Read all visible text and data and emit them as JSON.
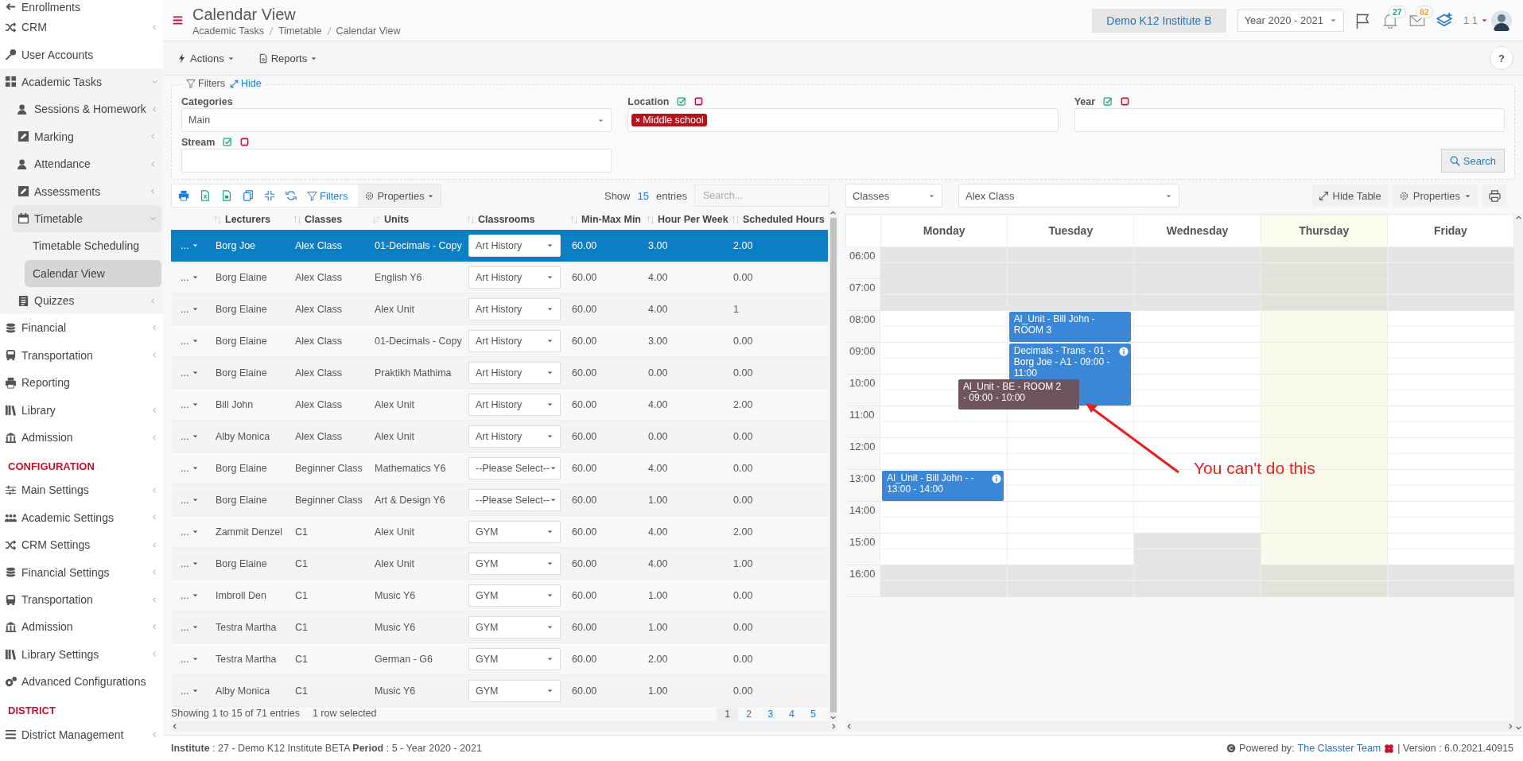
{
  "sidebar": {
    "items": [
      {
        "label": "Enrollments",
        "kind": "link",
        "selected": false
      },
      {
        "label": "CRM",
        "kind": "group",
        "expanded": false,
        "selected": false
      },
      {
        "label": "User Accounts",
        "kind": "link",
        "selected": false
      },
      {
        "label": "Academic Tasks",
        "kind": "group",
        "expanded": true,
        "selected": false,
        "children": [
          {
            "label": "Sessions & Homework",
            "kind": "group",
            "expanded": false,
            "selected": false
          },
          {
            "label": "Marking",
            "kind": "group",
            "expanded": false,
            "selected": false
          },
          {
            "label": "Attendance",
            "kind": "group",
            "expanded": false,
            "selected": false
          },
          {
            "label": "Assessments",
            "kind": "group",
            "expanded": false,
            "selected": false
          },
          {
            "label": "Timetable",
            "kind": "group",
            "expanded": true,
            "selected": false,
            "children": [
              {
                "label": "Timetable Scheduling",
                "kind": "link",
                "selected": false
              },
              {
                "label": "Calendar View",
                "kind": "link",
                "selected": true
              }
            ]
          },
          {
            "label": "Quizzes",
            "kind": "group",
            "expanded": false,
            "selected": false
          }
        ]
      },
      {
        "label": "Financial",
        "kind": "group",
        "expanded": false,
        "selected": false
      },
      {
        "label": "Transportation",
        "kind": "group",
        "expanded": false,
        "selected": false
      },
      {
        "label": "Reporting",
        "kind": "link",
        "selected": false
      },
      {
        "label": "Library",
        "kind": "group",
        "expanded": false,
        "selected": false
      },
      {
        "label": "Admission",
        "kind": "group",
        "expanded": false,
        "selected": false
      },
      {
        "label": "CONFIGURATION",
        "kind": "heading"
      },
      {
        "label": "Main Settings",
        "kind": "group",
        "expanded": false,
        "selected": false
      },
      {
        "label": "Academic Settings",
        "kind": "group",
        "expanded": false,
        "selected": false
      },
      {
        "label": "CRM Settings",
        "kind": "group",
        "expanded": false,
        "selected": false
      },
      {
        "label": "Financial Settings",
        "kind": "group",
        "expanded": false,
        "selected": false
      },
      {
        "label": "Transportation",
        "kind": "group",
        "expanded": false,
        "selected": false
      },
      {
        "label": "Admission",
        "kind": "group",
        "expanded": false,
        "selected": false
      },
      {
        "label": "Library Settings",
        "kind": "group",
        "expanded": false,
        "selected": false
      },
      {
        "label": "Advanced Configurations",
        "kind": "link",
        "selected": false
      },
      {
        "label": "DISTRICT",
        "kind": "heading"
      },
      {
        "label": "District Management",
        "kind": "group",
        "expanded": false,
        "selected": false
      }
    ]
  },
  "header": {
    "title": "Calendar View",
    "breadcrumb": [
      "Academic Tasks",
      "Timetable",
      "Calendar View"
    ],
    "institute": "Demo K12 Institute B",
    "year": "Year 2020 - 2021",
    "badges": [
      {
        "kind": "notifications",
        "count": "27",
        "color": "#1fa882"
      },
      {
        "kind": "messages",
        "count": "82",
        "color": "#f0a33a"
      }
    ],
    "user": "1 1"
  },
  "toolbar": {
    "menus": [
      "Actions",
      "Reports"
    ],
    "help": "?"
  },
  "filters": {
    "title": "Filters",
    "toggle": "Hide",
    "fields": [
      {
        "label": "Categories",
        "kind": "select",
        "value": "Main",
        "bulk": false
      },
      {
        "label": "Location",
        "kind": "tags",
        "tags": [
          "Middle school"
        ],
        "bulk": true
      },
      {
        "label": "Year",
        "kind": "text",
        "bulk": true
      },
      {
        "label": "Stream",
        "kind": "text",
        "bulk": true
      }
    ],
    "search_button": "Search"
  },
  "table": {
    "toolbar": {
      "filters": "Filters",
      "properties": "Properties",
      "show": "Show",
      "page_size": "15",
      "entries": "entries",
      "search_placeholder": "Search..."
    },
    "columns": [
      {
        "label": "Lecturers",
        "kind": "text",
        "sorted": false
      },
      {
        "label": "Classes",
        "kind": "text",
        "sorted": false
      },
      {
        "label": "Units",
        "kind": "text",
        "sorted": true
      },
      {
        "label": "Classrooms",
        "kind": "select",
        "sorted": false
      },
      {
        "label": "Min-Max Min",
        "kind": "text",
        "sorted": false
      },
      {
        "label": "Hour Per Week",
        "kind": "text",
        "sorted": false
      },
      {
        "label": "Scheduled Hours",
        "kind": "text",
        "sorted": false
      }
    ],
    "rows": [
      {
        "selected": true,
        "action": "...",
        "cells": [
          "Borg Joe",
          "Alex Class",
          "01-Decimals - Copy",
          "Art History",
          "60.00",
          "3.00",
          "2.00"
        ]
      },
      {
        "selected": false,
        "action": "...",
        "cells": [
          "Borg Elaine",
          "Alex Class",
          "English Y6",
          "Art History",
          "60.00",
          "4.00",
          "0.00"
        ]
      },
      {
        "selected": false,
        "action": "...",
        "cells": [
          "Borg Elaine",
          "Alex Class",
          "Alex Unit",
          "Art History",
          "60.00",
          "4.00",
          "1"
        ]
      },
      {
        "selected": false,
        "action": "...",
        "cells": [
          "Borg Elaine",
          "Alex Class",
          "01-Decimals - Copy",
          "Art History",
          "60.00",
          "3.00",
          "0.00"
        ]
      },
      {
        "selected": false,
        "action": "...",
        "cells": [
          "Borg Elaine",
          "Alex Class",
          "Praktikh Mathima",
          "Art History",
          "60.00",
          "0.00",
          "0.00"
        ]
      },
      {
        "selected": false,
        "action": "...",
        "cells": [
          "Bill John",
          "Alex Class",
          "Alex Unit",
          "Art History",
          "60.00",
          "4.00",
          "2.00"
        ]
      },
      {
        "selected": false,
        "action": "...",
        "cells": [
          "Alby Monica",
          "Alex Class",
          "Alex Unit",
          "Art History",
          "60.00",
          "0.00",
          "0.00"
        ]
      },
      {
        "selected": false,
        "action": "...",
        "cells": [
          "Borg Elaine",
          "Beginner Class",
          "Mathematics Y6",
          "--Please Select--",
          "60.00",
          "4.00",
          "0.00"
        ]
      },
      {
        "selected": false,
        "action": "...",
        "cells": [
          "Borg Elaine",
          "Beginner Class",
          "Art & Design Y6",
          "--Please Select--",
          "60.00",
          "1.00",
          "0.00"
        ]
      },
      {
        "selected": false,
        "action": "...",
        "cells": [
          "Zammit Denzel",
          "C1",
          "Alex Unit",
          "GYM",
          "60.00",
          "4.00",
          "2.00"
        ]
      },
      {
        "selected": false,
        "action": "...",
        "cells": [
          "Borg Elaine",
          "C1",
          "Alex Unit",
          "GYM",
          "60.00",
          "4.00",
          "1.00"
        ]
      },
      {
        "selected": false,
        "action": "...",
        "cells": [
          "Imbroll Den",
          "C1",
          "Music Y6",
          "GYM",
          "60.00",
          "1.00",
          "0.00"
        ]
      },
      {
        "selected": false,
        "action": "...",
        "cells": [
          "Testra Martha",
          "C1",
          "Music Y6",
          "GYM",
          "60.00",
          "1.00",
          "0.00"
        ]
      },
      {
        "selected": false,
        "action": "...",
        "cells": [
          "Testra Martha",
          "C1",
          "German - G6",
          "GYM",
          "60.00",
          "2.00",
          "0.00"
        ]
      },
      {
        "selected": false,
        "action": "...",
        "cells": [
          "Alby Monica",
          "C1",
          "Music Y6",
          "GYM",
          "60.00",
          "1.00",
          "0.00"
        ]
      }
    ],
    "info": "Showing 1 to 15 of 71 entries",
    "selection_info": "1 row selected",
    "pages": [
      {
        "label": "1",
        "selected": true
      },
      {
        "label": "2",
        "selected": false
      },
      {
        "label": "3",
        "selected": false
      },
      {
        "label": "4",
        "selected": false
      },
      {
        "label": "5",
        "selected": false
      }
    ]
  },
  "calendar": {
    "selects": [
      "Classes",
      "Alex Class"
    ],
    "buttons": [
      "Hide Table",
      "Properties"
    ],
    "days": [
      {
        "label": "Monday",
        "today": false
      },
      {
        "label": "Tuesday",
        "today": false
      },
      {
        "label": "Wednesday",
        "today": false
      },
      {
        "label": "Thursday",
        "today": true
      },
      {
        "label": "Friday",
        "today": false
      }
    ],
    "times": [
      {
        "label": "06:00",
        "slots": [
          {
            "shaded": true
          },
          {
            "shaded": true
          },
          {
            "shaded": true
          },
          {
            "shaded": true
          },
          {
            "shaded": true
          }
        ]
      },
      {
        "label": "07:00",
        "slots": [
          {
            "shaded": true
          },
          {
            "shaded": true
          },
          {
            "shaded": true
          },
          {
            "shaded": true
          },
          {
            "shaded": true
          }
        ]
      },
      {
        "label": "08:00",
        "slots": [
          {
            "shaded": false
          },
          {
            "shaded": false,
            "events": [
              {
                "kind": "event",
                "text": "Al_Unit - Bill John - ROOM 3",
                "color": "#3a87d8",
                "info": false
              }
            ]
          },
          {
            "shaded": false
          },
          {
            "shaded": false
          },
          {
            "shaded": false
          }
        ]
      },
      {
        "label": "09:00",
        "slots": [
          {
            "shaded": false
          },
          {
            "shaded": false,
            "events": [
              {
                "kind": "long_event",
                "text": "Decimals - Trans - 01 - Borg Joe - A1 - 09:00 - 11:00",
                "color": "#3a87d8",
                "info": true
              }
            ]
          },
          {
            "shaded": false
          },
          {
            "shaded": false
          },
          {
            "shaded": false
          }
        ]
      },
      {
        "label": "10:00",
        "slots": [
          {
            "shaded": false,
            "events": [
              {
                "kind": "dragging",
                "text": "Al_Unit - BE - ROOM 2 - 09:00 - 10:00",
                "color": "#6e545f",
                "info": false
              }
            ]
          },
          {
            "shaded": false
          },
          {
            "shaded": false
          },
          {
            "shaded": false
          },
          {
            "shaded": false
          }
        ]
      },
      {
        "label": "11:00",
        "slots": [
          {
            "shaded": false
          },
          {
            "shaded": false
          },
          {
            "shaded": false
          },
          {
            "shaded": false
          },
          {
            "shaded": false
          }
        ]
      },
      {
        "label": "12:00",
        "slots": [
          {
            "shaded": false
          },
          {
            "shaded": false
          },
          {
            "shaded": false
          },
          {
            "shaded": false
          },
          {
            "shaded": false
          }
        ]
      },
      {
        "label": "13:00",
        "slots": [
          {
            "shaded": false,
            "events": [
              {
                "kind": "event",
                "text": "Al_Unit - Bill John - - 13:00 - 14:00",
                "color": "#3a87d8",
                "info": true
              }
            ]
          },
          {
            "shaded": false
          },
          {
            "shaded": false
          },
          {
            "shaded": false
          },
          {
            "shaded": false
          }
        ]
      },
      {
        "label": "14:00",
        "slots": [
          {
            "shaded": false
          },
          {
            "shaded": false
          },
          {
            "shaded": false
          },
          {
            "shaded": false
          },
          {
            "shaded": false
          }
        ]
      },
      {
        "label": "15:00",
        "slots": [
          {
            "shaded": false
          },
          {
            "shaded": false
          },
          {
            "shaded": true
          },
          {
            "shaded": false
          },
          {
            "shaded": false
          }
        ]
      },
      {
        "label": "16:00",
        "slots": [
          {
            "shaded": true
          },
          {
            "shaded": true
          },
          {
            "shaded": true
          },
          {
            "shaded": true
          },
          {
            "shaded": true
          }
        ]
      }
    ],
    "annotation": {
      "text": "You can't do this"
    }
  },
  "footer": {
    "status": "**Institute** : 27 - Demo K12 Institute BETA **Period** : 5 - Year 2020 - 2021",
    "powered": "Powered by:",
    "team": "The Classter Team",
    "version": "| Version : 6.0.2021.40915"
  }
}
